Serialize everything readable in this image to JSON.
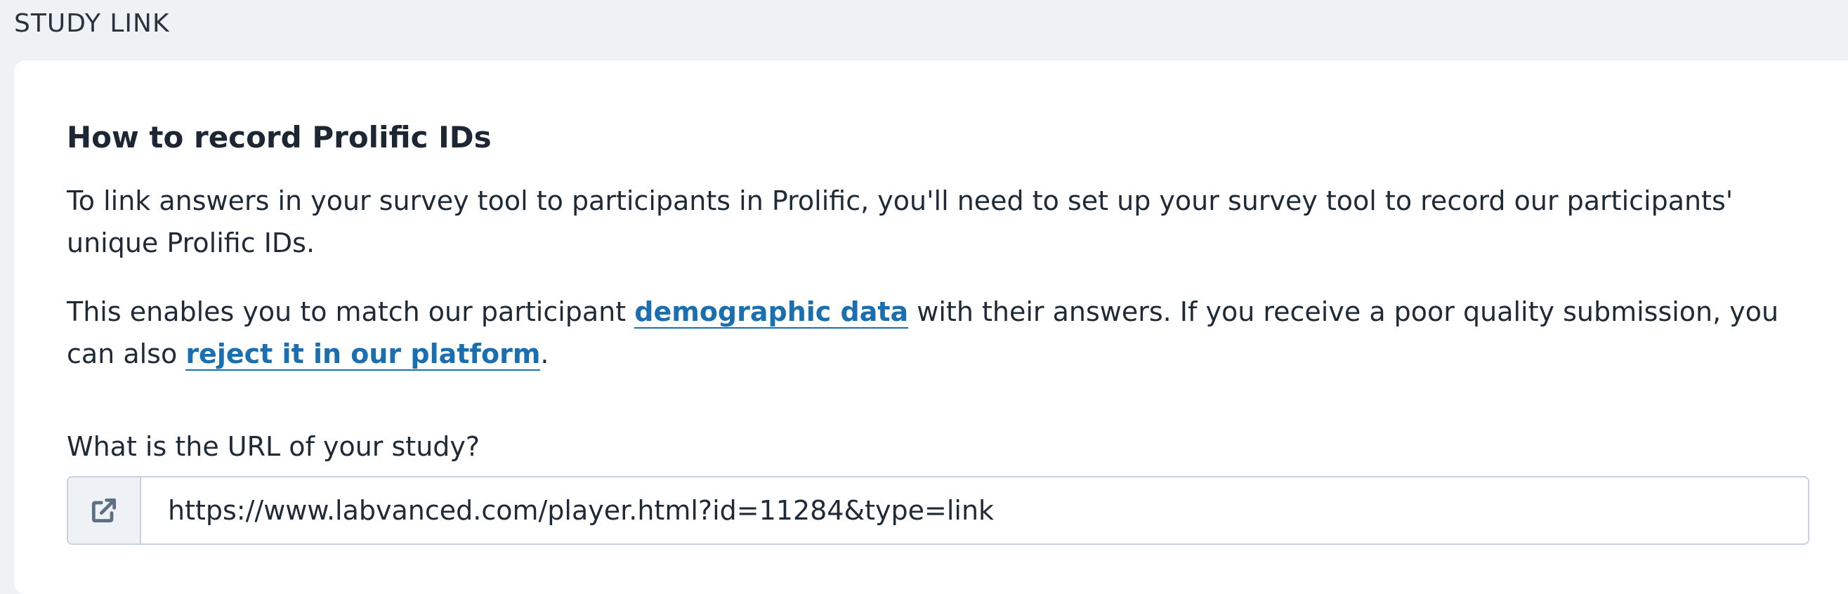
{
  "section": {
    "label": "STUDY LINK"
  },
  "card": {
    "heading": "How to record Prolific IDs",
    "paragraph1": "To link answers in your survey tool to participants in Prolific, you'll need to set up your survey tool to record our participants' unique Prolific IDs.",
    "paragraph2": {
      "text_before": "This enables you to match our participant ",
      "link1": "demographic data",
      "text_middle": " with their answers. If you receive a poor quality submission, you can also ",
      "link2": "reject it in our platform",
      "text_after": "."
    },
    "url_field": {
      "label": "What is the URL of your study?",
      "value": "https://www.labvanced.com/player.html?id=11284&type=link",
      "icon": "external-link-icon"
    }
  },
  "colors": {
    "background": "#eff2f5",
    "card": "#ffffff",
    "link": "#1a6fb1",
    "text": "#1f2a37",
    "border": "#c9d2dc",
    "icon": "#5c6f84"
  }
}
